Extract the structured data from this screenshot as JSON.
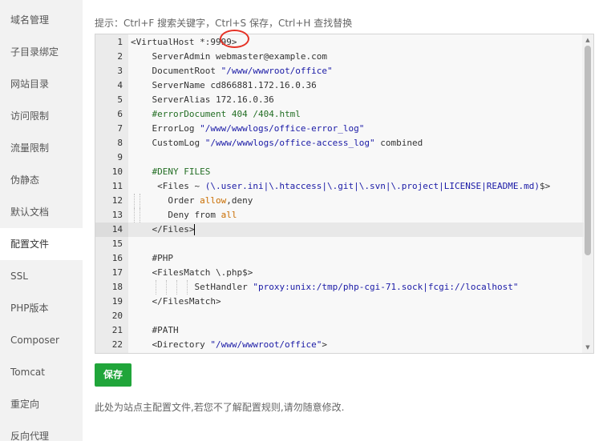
{
  "sidebar": {
    "items": [
      {
        "label": "域名管理",
        "active": false
      },
      {
        "label": "子目录绑定",
        "active": false
      },
      {
        "label": "网站目录",
        "active": false
      },
      {
        "label": "访问限制",
        "active": false
      },
      {
        "label": "流量限制",
        "active": false
      },
      {
        "label": "伪静态",
        "active": false
      },
      {
        "label": "默认文档",
        "active": false
      },
      {
        "label": "配置文件",
        "active": true
      },
      {
        "label": "SSL",
        "active": false
      },
      {
        "label": "PHP版本",
        "active": false
      },
      {
        "label": "Composer",
        "active": false
      },
      {
        "label": "Tomcat",
        "active": false
      },
      {
        "label": "重定向",
        "active": false
      },
      {
        "label": "反向代理",
        "active": false
      }
    ]
  },
  "main": {
    "hint": "提示：Ctrl+F 搜索关键字，Ctrl+S 保存，Ctrl+H 查找替换",
    "save_label": "保存",
    "note": "此处为站点主配置文件,若您不了解配置规则,请勿随意修改."
  },
  "editor": {
    "active_line": 14,
    "lines": [
      {
        "n": "1",
        "tokens": [
          [
            "t",
            "<VirtualHost *:9999>"
          ]
        ]
      },
      {
        "n": "2",
        "tokens": [
          [
            "t",
            "    ServerAdmin webmaster@example.com"
          ]
        ]
      },
      {
        "n": "3",
        "tokens": [
          [
            "t",
            "    DocumentRoot "
          ],
          [
            "s",
            "\"/www/wwwroot/office\""
          ]
        ]
      },
      {
        "n": "4",
        "tokens": [
          [
            "t",
            "    ServerName cd866881.172.16.0.36"
          ]
        ]
      },
      {
        "n": "5",
        "tokens": [
          [
            "t",
            "    ServerAlias 172.16.0.36"
          ]
        ]
      },
      {
        "n": "6",
        "tokens": [
          [
            "t",
            "    "
          ],
          [
            "c",
            "#errorDocument 404 /404.html"
          ]
        ]
      },
      {
        "n": "7",
        "tokens": [
          [
            "t",
            "    ErrorLog "
          ],
          [
            "s",
            "\"/www/wwwlogs/office-error_log\""
          ]
        ]
      },
      {
        "n": "8",
        "tokens": [
          [
            "t",
            "    CustomLog "
          ],
          [
            "s",
            "\"/www/wwwlogs/office-access_log\""
          ],
          [
            "t",
            " combined"
          ]
        ]
      },
      {
        "n": "9",
        "tokens": []
      },
      {
        "n": "10",
        "tokens": [
          [
            "t",
            "    "
          ],
          [
            "c",
            "#DENY FILES"
          ]
        ]
      },
      {
        "n": "11",
        "tokens": [
          [
            "t",
            "     <Files ~ "
          ],
          [
            "s",
            "(\\.user.ini|\\.htaccess|\\.git|\\.svn|\\.project|LICENSE|README.md)"
          ],
          [
            "t",
            "$>"
          ]
        ]
      },
      {
        "n": "12",
        "tokens": [
          [
            "t",
            "       Order "
          ],
          [
            "k",
            "allow"
          ],
          [
            "t",
            ",deny"
          ]
        ]
      },
      {
        "n": "13",
        "tokens": [
          [
            "t",
            "       Deny from "
          ],
          [
            "k",
            "all"
          ]
        ]
      },
      {
        "n": "14",
        "tokens": [
          [
            "t",
            "    </Files>"
          ]
        ]
      },
      {
        "n": "15",
        "tokens": []
      },
      {
        "n": "16",
        "tokens": [
          [
            "t",
            "    #PHP"
          ]
        ]
      },
      {
        "n": "17",
        "tokens": [
          [
            "t",
            "    <FilesMatch \\.php$>"
          ]
        ]
      },
      {
        "n": "18",
        "tokens": [
          [
            "t",
            "            SetHandler "
          ],
          [
            "s",
            "\"proxy:unix:/tmp/php-cgi-71.sock|fcgi://localhost\""
          ]
        ]
      },
      {
        "n": "19",
        "tokens": [
          [
            "t",
            "    </FilesMatch>"
          ]
        ]
      },
      {
        "n": "20",
        "tokens": []
      },
      {
        "n": "21",
        "tokens": [
          [
            "t",
            "    #PATH"
          ]
        ]
      },
      {
        "n": "22",
        "tokens": [
          [
            "t",
            "    <Directory "
          ],
          [
            "s",
            "\"/www/wwwroot/office\""
          ],
          [
            "t",
            ">"
          ]
        ]
      }
    ]
  },
  "colors": {
    "accent": "#20a53a",
    "annotation": "#e53226",
    "string": "#1a1aa6",
    "comment": "#236e24",
    "keyword": "#c96d00"
  }
}
